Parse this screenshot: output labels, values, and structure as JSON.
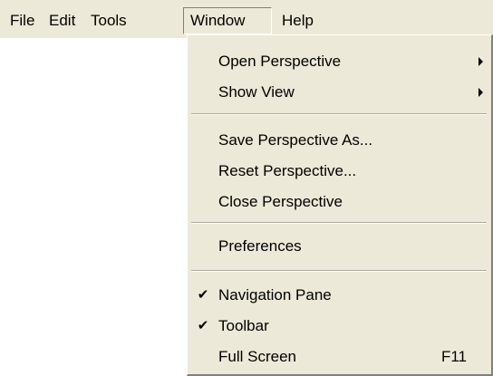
{
  "menubar": {
    "items": [
      {
        "label": "File"
      },
      {
        "label": "Edit"
      },
      {
        "label": "Tools"
      },
      {
        "label": "Window"
      },
      {
        "label": "Help"
      }
    ],
    "active_item": "Window"
  },
  "window_menu": {
    "items": [
      {
        "label": "Open Perspective",
        "has_submenu": true,
        "checked": false
      },
      {
        "label": "Show View",
        "has_submenu": true,
        "checked": false
      },
      {
        "label": "Save Perspective As...",
        "has_submenu": false,
        "checked": false
      },
      {
        "label": "Reset Perspective...",
        "has_submenu": false,
        "checked": false
      },
      {
        "label": "Close Perspective",
        "has_submenu": false,
        "checked": false
      },
      {
        "label": "Preferences",
        "has_submenu": false,
        "checked": false
      },
      {
        "label": "Navigation Pane",
        "has_submenu": false,
        "checked": true,
        "check_glyph": "✔"
      },
      {
        "label": "Toolbar",
        "has_submenu": false,
        "checked": true,
        "check_glyph": "✔"
      },
      {
        "label": "Full Screen",
        "has_submenu": false,
        "checked": false,
        "shortcut": "F11"
      }
    ]
  },
  "colors": {
    "menu_background": "#ece9d8",
    "text": "#000000",
    "separator_dark": "#aca899",
    "separator_light": "#ffffff"
  },
  "icons": {
    "submenu": "submenu-arrow-icon",
    "check": "checkmark-icon"
  }
}
